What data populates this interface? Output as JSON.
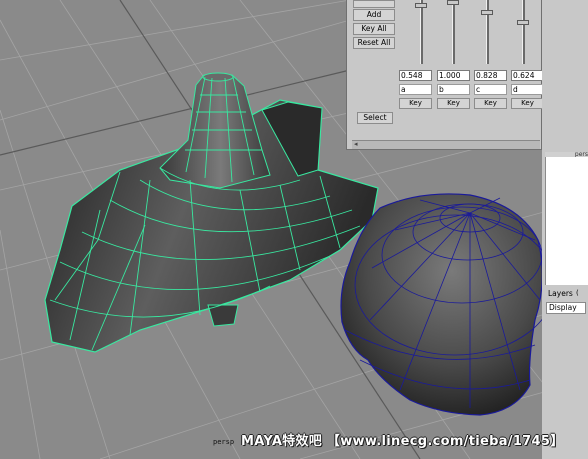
{
  "blend_panel": {
    "buttons": [
      "Add",
      "Key All",
      "Reset All"
    ],
    "select_label": "Select",
    "targets": [
      {
        "value": "0.548",
        "name": "a",
        "key_label": "Key",
        "level": 0.548
      },
      {
        "value": "1.000",
        "name": "b",
        "key_label": "Key",
        "level": 1.0
      },
      {
        "value": "0.828",
        "name": "c",
        "key_label": "Key",
        "level": 0.828
      },
      {
        "value": "0.624",
        "name": "d",
        "key_label": "Key",
        "level": 0.624
      }
    ]
  },
  "right_panel": {
    "persp_tab": "pers",
    "layers_label": "Layers",
    "layers_option": "(",
    "display_label": "Display"
  },
  "viewport": {
    "camera_label": "persp",
    "watermark": "MAYA特效吧 【www.linecg.com/tieba/1745】"
  },
  "colors": {
    "viewport_bg": "#8a8a8a",
    "grid": "#9e9e9e",
    "selected_wire": "#39e8a0",
    "unselected_wire": "#1a1a9a",
    "panel_bg": "#c8c8c8"
  }
}
